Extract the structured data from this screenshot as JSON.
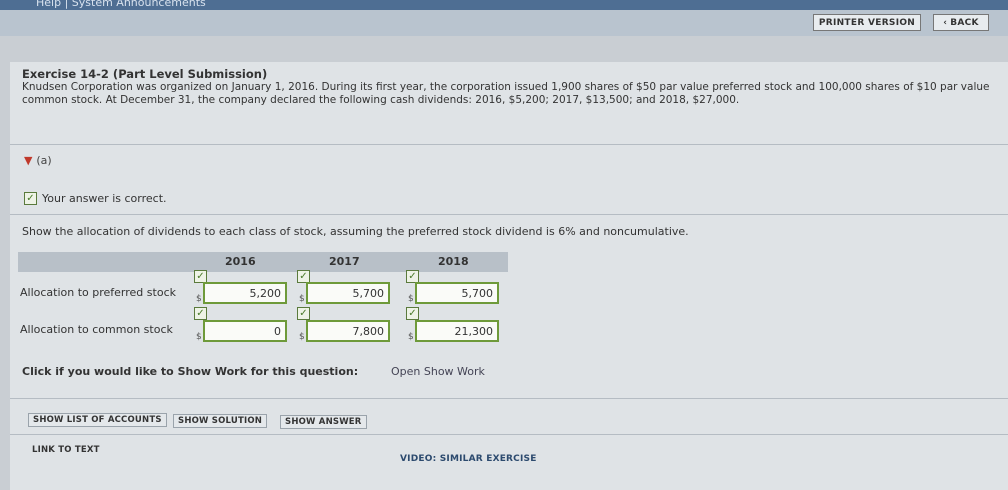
{
  "topbar": {
    "links": "Help | System Announcements"
  },
  "toolbar": {
    "printer_version": "PRINTER VERSION",
    "back": "BACK"
  },
  "exercise": {
    "title": "Exercise 14-2 (Part Level Submission)",
    "description": "Knudsen Corporation was organized on January 1, 2016. During its first year, the corporation issued 1,900 shares of $50 par value preferred stock and 100,000 shares of $10 par value common stock. At December 31, the company declared the following cash dividends: 2016, $5,200; 2017, $13,500; and 2018, $27,000."
  },
  "part": {
    "label": "(a)",
    "status": "Your answer is correct.",
    "question": "Show the allocation of dividends to each class of stock, assuming the preferred stock dividend is 6% and noncumulative."
  },
  "table": {
    "columns": [
      "2016",
      "2017",
      "2018"
    ],
    "currency": "$",
    "rows": [
      {
        "label": "Allocation to preferred stock",
        "values": [
          "5,200",
          "5,700",
          "5,700"
        ]
      },
      {
        "label": "Allocation to common stock",
        "values": [
          "0",
          "7,800",
          "21,300"
        ]
      }
    ]
  },
  "show_work": {
    "prompt": "Click if you would like to Show Work for this question:",
    "link": "Open Show Work"
  },
  "actions": {
    "show_list_of_accounts": "SHOW LIST OF ACCOUNTS",
    "show_solution": "SHOW SOLUTION",
    "show_answer": "SHOW ANSWER",
    "link_to_text": "LINK TO TEXT",
    "video": "VIDEO: SIMILAR EXERCISE"
  },
  "colors": {
    "topbar": "#4e6e93",
    "correct_border": "#6e9a3a",
    "part_marker": "#c0392b"
  }
}
